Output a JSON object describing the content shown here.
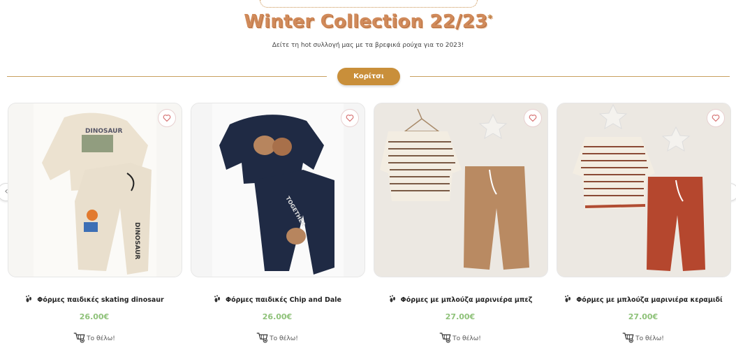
{
  "header": {
    "title": "Winter Collection 22/23",
    "title_mark": "*",
    "subtitle": "Δείτε τη hot συλλογή μας με τα βρεφικά ρούχα για το 2023!",
    "category_button": "Κορίτσι"
  },
  "colors": {
    "title": "#d08a5a",
    "accent": "#c98f3a",
    "price": "#8fc27a"
  },
  "products": [
    {
      "name": "Φόρμες παιδικές skating dinosaur",
      "price": "26.00€",
      "cta": "Το θέλω!"
    },
    {
      "name": "Φόρμες παιδικές Chip and Dale",
      "price": "26.00€",
      "cta": "Το θέλω!"
    },
    {
      "name": "Φόρμες με μπλούζα μαρινιέρα μπεζ",
      "price": "27.00€",
      "cta": "Το θέλω!"
    },
    {
      "name": "Φόρμες με μπλούζα μαρινιέρα κεραμιδί",
      "price": "27.00€",
      "cta": "Το θέλω!"
    }
  ],
  "icons": {
    "wishlist": "heart-icon",
    "product_mark": "footprint-icon",
    "cta": "cart-add-icon",
    "prev": "chevron-left-icon",
    "next": "chevron-right-icon"
  }
}
